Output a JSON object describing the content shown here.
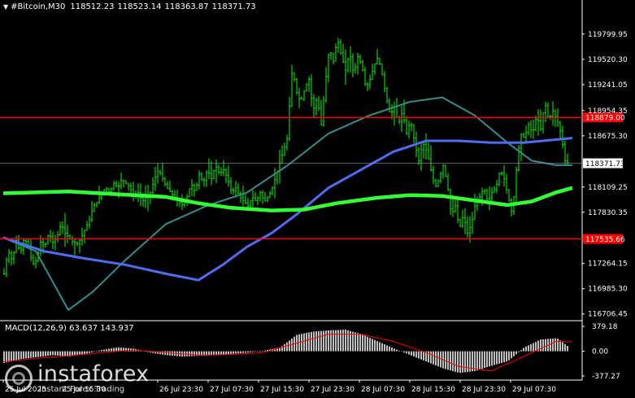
{
  "header": {
    "symbol": "#Bitcoin,M30",
    "open": "118512.23",
    "high": "118523.14",
    "low": "118363.87",
    "close": "118371.73"
  },
  "macd": {
    "label": "MACD(12,26,9) 63.637 143.937",
    "axis_labels": [
      "379.18",
      "0.00",
      "-377.27"
    ]
  },
  "price_axis": {
    "labels": [
      "119799.95",
      "119520.30",
      "119241.05",
      "118954.35",
      "118675.30",
      "118109.25",
      "117830.35",
      "117264.15",
      "116985.30",
      "116706.45"
    ]
  },
  "levels": [
    {
      "name": "resistance",
      "value": "118879.00",
      "color": "#ff0000"
    },
    {
      "name": "support",
      "value": "117535.66",
      "color": "#ff0000"
    },
    {
      "name": "current",
      "value": "118371.73",
      "color": "#ffffff"
    }
  ],
  "time_axis": {
    "labels": [
      "25 Jul 2025",
      "25 Jul 15:30",
      "26 Jul 23:30",
      "27 Jul 07:30",
      "27 Jul 15:30",
      "27 Jul 23:30",
      "28 Jul 07:30",
      "28 Jul 15:30",
      "28 Jul 23:30",
      "29 Jul 07:30"
    ]
  },
  "watermark": {
    "name": "instaforex",
    "tagline": "Instant Forex Trading"
  },
  "colors": {
    "background": "#000000",
    "candles": "#00ff00",
    "ma_fast": "#2f8f8f",
    "ma_mid": "#4d6ef0",
    "ma_slow": "#32ff32",
    "macd_hist": "#c0c0c0",
    "macd_signal": "#ff0000",
    "level_line": "#ff0000"
  },
  "chart_data": [
    {
      "type": "candlestick",
      "title": "#Bitcoin,M30",
      "timeframe": "M30",
      "ylim": [
        116650,
        120050
      ],
      "y_ticks": [
        119799.95,
        119520.3,
        119241.05,
        118954.35,
        118675.3,
        118109.25,
        117830.35,
        117264.15,
        116985.3,
        116706.45
      ],
      "x_tick_labels": [
        "25 Jul 2025",
        "25 Jul 15:30",
        "26 Jul 23:30",
        "27 Jul 07:30",
        "27 Jul 15:30",
        "27 Jul 23:30",
        "28 Jul 07:30",
        "28 Jul 15:30",
        "28 Jul 23:30",
        "29 Jul 07:30"
      ],
      "horizontal_lines": [
        118879.0,
        117535.66
      ],
      "last_price": 118371.73,
      "close_path": [
        [
          0,
          117150
        ],
        [
          5,
          117400
        ],
        [
          10,
          117300
        ],
        [
          15,
          117520
        ],
        [
          20,
          117380
        ],
        [
          25,
          117550
        ],
        [
          30,
          117450
        ],
        [
          35,
          117250
        ],
        [
          40,
          117300
        ],
        [
          45,
          117500
        ],
        [
          50,
          117450
        ],
        [
          55,
          117600
        ],
        [
          60,
          117500
        ],
        [
          65,
          117550
        ],
        [
          70,
          117700
        ],
        [
          75,
          117600
        ],
        [
          80,
          117550
        ],
        [
          85,
          117500
        ],
        [
          90,
          117480
        ],
        [
          95,
          117550
        ],
        [
          100,
          117650
        ],
        [
          105,
          117750
        ],
        [
          110,
          117900
        ],
        [
          115,
          117950
        ],
        [
          120,
          118050
        ],
        [
          125,
          118100
        ],
        [
          130,
          118050
        ],
        [
          135,
          118150
        ],
        [
          140,
          118100
        ],
        [
          145,
          118200
        ],
        [
          150,
          118150
        ],
        [
          155,
          118100
        ],
        [
          160,
          118000
        ],
        [
          165,
          118050
        ],
        [
          170,
          117950
        ],
        [
          175,
          118000
        ],
        [
          180,
          118050
        ],
        [
          185,
          118200
        ],
        [
          190,
          118300
        ],
        [
          195,
          118200
        ],
        [
          200,
          118100
        ],
        [
          205,
          118050
        ],
        [
          210,
          117980
        ],
        [
          215,
          117950
        ],
        [
          220,
          117900
        ],
        [
          225,
          118000
        ],
        [
          230,
          118150
        ],
        [
          235,
          118050
        ],
        [
          240,
          118250
        ],
        [
          245,
          118150
        ],
        [
          250,
          118300
        ],
        [
          255,
          118200
        ],
        [
          260,
          118350
        ],
        [
          265,
          118250
        ],
        [
          270,
          118300
        ],
        [
          275,
          118200
        ],
        [
          280,
          118050
        ],
        [
          285,
          118100
        ],
        [
          290,
          118000
        ],
        [
          295,
          117950
        ],
        [
          300,
          117900
        ],
        [
          305,
          118000
        ],
        [
          310,
          117950
        ],
        [
          315,
          118050
        ],
        [
          320,
          117950
        ],
        [
          325,
          118000
        ],
        [
          330,
          118100
        ],
        [
          335,
          118250
        ],
        [
          340,
          118400
        ],
        [
          345,
          118550
        ],
        [
          350,
          118700
        ],
        [
          352,
          119300
        ],
        [
          355,
          119400
        ],
        [
          360,
          119150
        ],
        [
          365,
          119050
        ],
        [
          370,
          119200
        ],
        [
          375,
          119300
        ],
        [
          380,
          118950
        ],
        [
          385,
          119100
        ],
        [
          390,
          118800
        ],
        [
          395,
          119250
        ],
        [
          400,
          119650
        ],
        [
          405,
          119500
        ],
        [
          410,
          119750
        ],
        [
          415,
          119550
        ],
        [
          420,
          119400
        ],
        [
          425,
          119600
        ],
        [
          430,
          119350
        ],
        [
          435,
          119550
        ],
        [
          440,
          119450
        ],
        [
          445,
          119200
        ],
        [
          450,
          119300
        ],
        [
          455,
          119450
        ],
        [
          460,
          119550
        ],
        [
          465,
          119350
        ],
        [
          470,
          119100
        ],
        [
          475,
          118900
        ],
        [
          480,
          119000
        ],
        [
          485,
          118800
        ],
        [
          490,
          118950
        ],
        [
          495,
          118700
        ],
        [
          500,
          118850
        ],
        [
          505,
          118600
        ],
        [
          510,
          118400
        ],
        [
          515,
          118600
        ],
        [
          520,
          118500
        ],
        [
          525,
          118300
        ],
        [
          530,
          118100
        ],
        [
          535,
          118200
        ],
        [
          540,
          118350
        ],
        [
          545,
          118150
        ],
        [
          550,
          117800
        ],
        [
          555,
          117900
        ],
        [
          560,
          117650
        ],
        [
          565,
          117800
        ],
        [
          570,
          117600
        ],
        [
          575,
          117700
        ],
        [
          580,
          117950
        ],
        [
          585,
          118000
        ],
        [
          590,
          118100
        ],
        [
          595,
          117950
        ],
        [
          600,
          118050
        ],
        [
          605,
          118100
        ],
        [
          610,
          118300
        ],
        [
          615,
          118200
        ],
        [
          620,
          118000
        ],
        [
          625,
          117800
        ],
        [
          630,
          118300
        ],
        [
          635,
          118700
        ],
        [
          640,
          118650
        ],
        [
          645,
          118800
        ],
        [
          650,
          118700
        ],
        [
          655,
          118900
        ],
        [
          660,
          118750
        ],
        [
          665,
          119050
        ],
        [
          670,
          118850
        ],
        [
          675,
          118950
        ],
        [
          680,
          118850
        ],
        [
          685,
          118700
        ],
        [
          690,
          118400
        ],
        [
          695,
          118372
        ]
      ],
      "ma_fast_path": [
        [
          0,
          117550
        ],
        [
          40,
          117400
        ],
        [
          80,
          116750
        ],
        [
          110,
          116950
        ],
        [
          150,
          117300
        ],
        [
          200,
          117700
        ],
        [
          250,
          117900
        ],
        [
          300,
          118050
        ],
        [
          350,
          118350
        ],
        [
          400,
          118700
        ],
        [
          450,
          118900
        ],
        [
          500,
          119050
        ],
        [
          540,
          119100
        ],
        [
          580,
          118900
        ],
        [
          620,
          118600
        ],
        [
          650,
          118400
        ],
        [
          680,
          118350
        ],
        [
          700,
          118350
        ]
      ],
      "ma_mid_path": [
        [
          0,
          117550
        ],
        [
          50,
          117400
        ],
        [
          100,
          117320
        ],
        [
          150,
          117250
        ],
        [
          200,
          117150
        ],
        [
          240,
          117080
        ],
        [
          270,
          117250
        ],
        [
          300,
          117450
        ],
        [
          330,
          117600
        ],
        [
          360,
          117800
        ],
        [
          400,
          118100
        ],
        [
          440,
          118300
        ],
        [
          480,
          118500
        ],
        [
          520,
          118620
        ],
        [
          560,
          118620
        ],
        [
          600,
          118600
        ],
        [
          640,
          118600
        ],
        [
          700,
          118650
        ]
      ],
      "ma_slow_path": [
        [
          0,
          118040
        ],
        [
          80,
          118060
        ],
        [
          140,
          118030
        ],
        [
          200,
          118000
        ],
        [
          240,
          117930
        ],
        [
          280,
          117880
        ],
        [
          330,
          117850
        ],
        [
          370,
          117860
        ],
        [
          410,
          117930
        ],
        [
          460,
          117990
        ],
        [
          500,
          118020
        ],
        [
          540,
          118010
        ],
        [
          580,
          117960
        ],
        [
          620,
          117910
        ],
        [
          650,
          117950
        ],
        [
          680,
          118050
        ],
        [
          700,
          118100
        ]
      ]
    },
    {
      "type": "bar",
      "title": "MACD(12,26,9)",
      "values_label": [
        "63.637",
        "143.937"
      ],
      "ylim": [
        -377.27,
        379.18
      ],
      "y_ticks": [
        379.18,
        0.0,
        -377.27
      ],
      "histogram": [
        [
          0,
          -180
        ],
        [
          20,
          -120
        ],
        [
          40,
          -90
        ],
        [
          60,
          -60
        ],
        [
          80,
          -80
        ],
        [
          100,
          -40
        ],
        [
          120,
          20
        ],
        [
          140,
          60
        ],
        [
          160,
          40
        ],
        [
          180,
          -20
        ],
        [
          200,
          -60
        ],
        [
          220,
          -80
        ],
        [
          240,
          -70
        ],
        [
          260,
          -60
        ],
        [
          280,
          -40
        ],
        [
          300,
          -20
        ],
        [
          320,
          10
        ],
        [
          340,
          60
        ],
        [
          360,
          250
        ],
        [
          380,
          300
        ],
        [
          400,
          320
        ],
        [
          420,
          330
        ],
        [
          440,
          260
        ],
        [
          460,
          150
        ],
        [
          480,
          40
        ],
        [
          500,
          -60
        ],
        [
          520,
          -160
        ],
        [
          540,
          -260
        ],
        [
          560,
          -330
        ],
        [
          580,
          -300
        ],
        [
          600,
          -220
        ],
        [
          620,
          -150
        ],
        [
          640,
          60
        ],
        [
          660,
          180
        ],
        [
          680,
          200
        ],
        [
          695,
          63.6
        ]
      ],
      "signal": [
        [
          0,
          -160
        ],
        [
          40,
          -110
        ],
        [
          80,
          -70
        ],
        [
          120,
          -20
        ],
        [
          160,
          20
        ],
        [
          200,
          -20
        ],
        [
          240,
          -60
        ],
        [
          280,
          -50
        ],
        [
          320,
          -20
        ],
        [
          360,
          120
        ],
        [
          400,
          260
        ],
        [
          440,
          260
        ],
        [
          480,
          150
        ],
        [
          520,
          -20
        ],
        [
          560,
          -230
        ],
        [
          600,
          -300
        ],
        [
          640,
          -80
        ],
        [
          680,
          150
        ],
        [
          700,
          143.9
        ]
      ]
    }
  ]
}
